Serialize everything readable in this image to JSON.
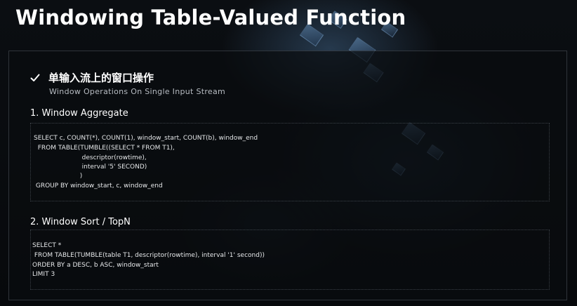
{
  "slide": {
    "title": "Windowing Table-Valued Function"
  },
  "heading": {
    "title_zh": "单输入流上的窗口操作",
    "title_en": "Window Operations On Single Input Stream",
    "icon": "check-icon"
  },
  "sections": [
    {
      "title": "1.  Window Aggregate",
      "code": [
        "SELECT c, COUNT(*), COUNT(1), window_start, COUNT(b), window_end",
        "  FROM TABLE(TUMBLE((SELECT * FROM T1),",
        "                        descriptor(rowtime),",
        "                        interval '5' SECOND)",
        "                       )",
        " GROUP BY window_start, c, window_end"
      ]
    },
    {
      "title": "2.  Window Sort / TopN",
      "code": [
        "SELECT *",
        " FROM TABLE(TUMBLE(table T1, descriptor(rowtime), interval '1' second))",
        "ORDER BY a DESC, b ASC, window_start",
        "LIMIT 3"
      ]
    }
  ]
}
